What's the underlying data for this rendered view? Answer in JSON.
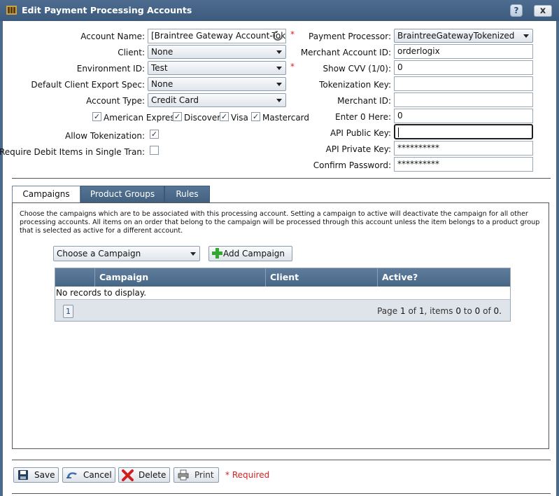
{
  "window": {
    "title": "Edit Payment Processing Accounts",
    "help_label": "?",
    "close_label": "x"
  },
  "form_left": {
    "account_name": {
      "label": "Account Name:",
      "value": "[Braintree Gateway Account-Tokenized]"
    },
    "client": {
      "label": "Client:",
      "value": "None"
    },
    "environment_id": {
      "label": "Environment ID:",
      "value": "Test"
    },
    "default_client_export_spec": {
      "label": "Default Client Export Spec:",
      "value": "None"
    },
    "account_type": {
      "label": "Account Type:",
      "value": "Credit Card"
    },
    "card_types": [
      {
        "label": "American Express",
        "checked": true
      },
      {
        "label": "Discover",
        "checked": true
      },
      {
        "label": "Visa",
        "checked": true
      },
      {
        "label": "Mastercard",
        "checked": true
      }
    ],
    "allow_tokenization": {
      "label": "Allow Tokenization:",
      "checked": true
    },
    "require_debit_items": {
      "label": "Require Debit Items in Single Tran:",
      "checked": false
    }
  },
  "form_right": {
    "payment_processor": {
      "label": "Payment Processor:",
      "value": "BraintreeGatewayTokenized"
    },
    "merchant_account_id": {
      "label": "Merchant Account ID:",
      "value": "orderlogix"
    },
    "show_cvv": {
      "label": "Show CVV (1/0):",
      "value": "0"
    },
    "tokenization_key": {
      "label": "Tokenization Key:",
      "value": ""
    },
    "merchant_id": {
      "label": "Merchant ID:",
      "value": ""
    },
    "enter_0_here": {
      "label": "Enter 0 Here:",
      "value": "0"
    },
    "api_public_key": {
      "label": "API Public Key:",
      "value": ""
    },
    "api_private_key": {
      "label": "API Private Key:",
      "value": "**********"
    },
    "confirm_password": {
      "label": "Confirm Password:",
      "value": "**********"
    }
  },
  "required_mark": "*",
  "tabs": [
    {
      "label": "Campaigns",
      "active": true
    },
    {
      "label": "Product Groups",
      "active": false
    },
    {
      "label": "Rules",
      "active": false
    }
  ],
  "campaigns": {
    "description": "Choose the campaigns which are to be associated with this processing account. Setting a campaign to active will deactivate the campaign for all other processing accounts. All items on an order that belong to the campaign will be processed through this account unless the item belongs to a product group that is selected as active for a different account.",
    "choose_placeholder": "Choose a Campaign",
    "add_button": "Add Campaign",
    "columns": [
      "Campaign",
      "Client",
      "Active?"
    ],
    "empty_message": "No records to display.",
    "pager": {
      "current_page": "1",
      "page_label": "Page",
      "page": "1",
      "of_label": "of",
      "total_pages": "1",
      "items_label": ", items",
      "from": "0",
      "to_label": "to",
      "to": "0",
      "of2_label": "of",
      "total": "0."
    }
  },
  "footer": {
    "save": "Save",
    "cancel": "Cancel",
    "delete": "Delete",
    "print": "Print",
    "required_note": "* Required"
  },
  "colors": {
    "titlebar": "#3c5a7c",
    "required": "#d42020",
    "grid_header": "#476684"
  }
}
